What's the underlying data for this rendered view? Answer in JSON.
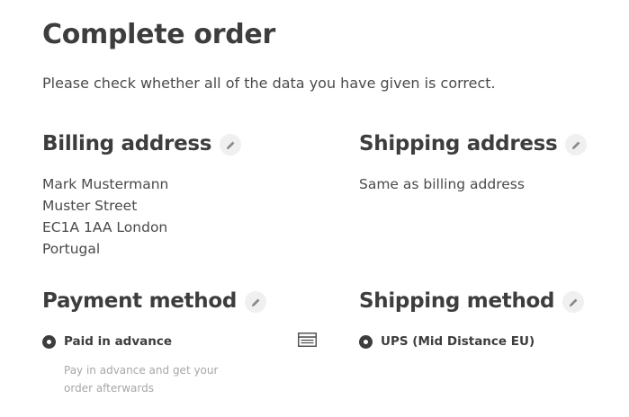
{
  "page": {
    "title": "Complete order",
    "subtitle": "Please check whether all of the data you have given is correct."
  },
  "billing": {
    "title": "Billing address",
    "edit_icon": "pencil-icon",
    "lines": [
      "Mark Mustermann",
      "Muster Street",
      "EC1A 1AA London",
      "Portugal"
    ]
  },
  "shipping_address": {
    "title": "Shipping address",
    "edit_icon": "pencil-icon",
    "text": "Same as billing address"
  },
  "payment": {
    "title": "Payment method",
    "edit_icon": "pencil-icon",
    "selected_label": "Paid in advance",
    "description": "Pay in advance and get your order afterwards",
    "method_icon": "invoice-card-icon"
  },
  "shipping_method": {
    "title": "Shipping method",
    "edit_icon": "pencil-icon",
    "selected_label": "UPS (Mid Distance EU)"
  },
  "colors": {
    "text": "#3d3d3d",
    "muted": "#a7a7a7",
    "edit_bg": "#f0f0f0"
  }
}
